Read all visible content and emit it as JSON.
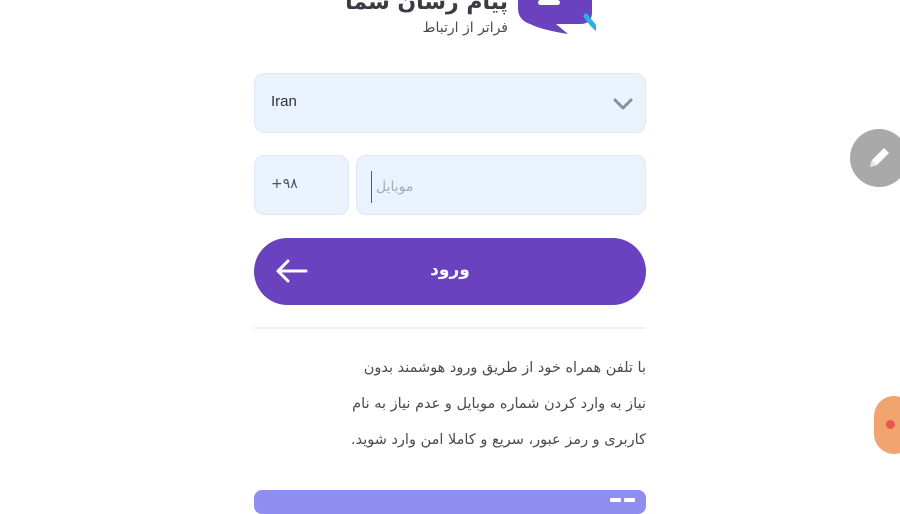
{
  "logo": {
    "title": "پیام رسان شما",
    "tagline": "فراتر از ارتباط",
    "icon": "chat-bubble-logo-icon",
    "colors": {
      "bubble": "#6a42bf",
      "accent": "#2bb0e0"
    }
  },
  "form": {
    "country": {
      "value": "Iran",
      "icon": "chevron-down-icon"
    },
    "country_code": {
      "value": "+۹۸"
    },
    "mobile": {
      "value": "",
      "placeholder": "موبایل"
    },
    "login_button": {
      "label": "ورود",
      "icon": "arrow-left-icon",
      "color": "#6a42bf"
    }
  },
  "description": {
    "line1": "با تلفن همراه خود از طریق ورود هوشمند بدون",
    "line2": "نیاز به وارد کردن شماره موبایل و عدم نیاز به نام",
    "line3": "کاربری و رمز عبور، سریع و کاملا امن وارد شوید."
  },
  "bottom_bar": {
    "color": "#8d8ef0",
    "icon": "menu-icon"
  },
  "floating": {
    "edit_button": {
      "icon": "pencil-icon"
    },
    "side_button": {
      "icon": "record-dot-icon"
    }
  }
}
